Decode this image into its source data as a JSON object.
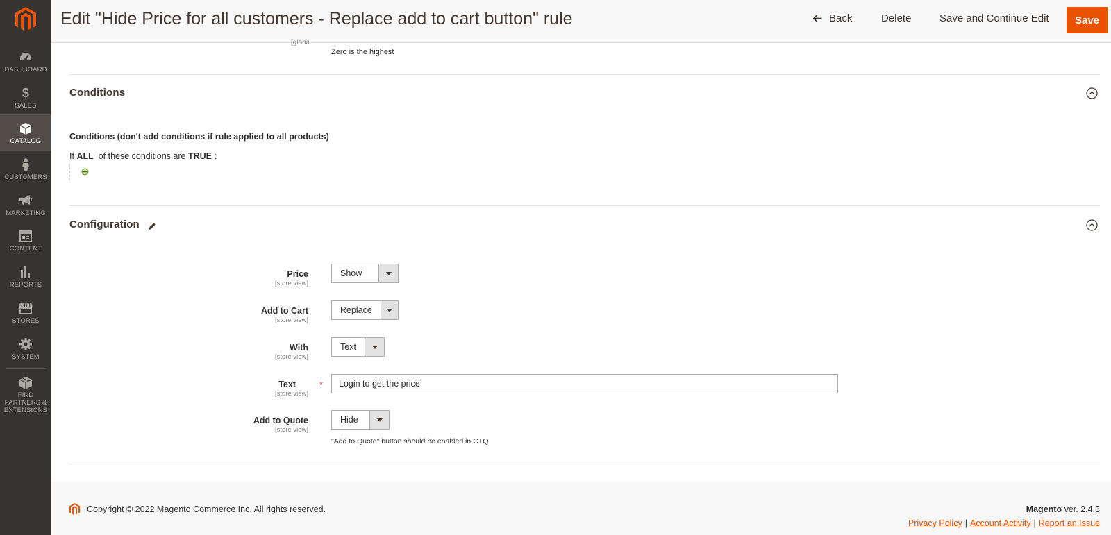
{
  "header": {
    "title": "Edit \"Hide Price for all customers - Replace add to cart button\" rule",
    "back_label": "Back",
    "delete_label": "Delete",
    "save_continue_label": "Save and Continue Edit",
    "save_label": "Save"
  },
  "sidebar": {
    "items": [
      {
        "label": "DASHBOARD",
        "icon": "dashboard-icon"
      },
      {
        "label": "SALES",
        "icon": "dollar-icon"
      },
      {
        "label": "CATALOG",
        "icon": "box-icon",
        "active": true
      },
      {
        "label": "CUSTOMERS",
        "icon": "person-icon"
      },
      {
        "label": "MARKETING",
        "icon": "megaphone-icon"
      },
      {
        "label": "CONTENT",
        "icon": "layout-icon"
      },
      {
        "label": "REPORTS",
        "icon": "bar-chart-icon"
      },
      {
        "label": "STORES",
        "icon": "storefront-icon"
      },
      {
        "label": "SYSTEM",
        "icon": "gear-icon"
      },
      {
        "label": "FIND PARTNERS & EXTENSIONS",
        "icon": "cubes-icon"
      }
    ]
  },
  "priority": {
    "scope": "[global]",
    "note": "Zero is the highest"
  },
  "conditions": {
    "section_title": "Conditions",
    "heading": "Conditions (don't add conditions if rule applied to all products)",
    "prefix": "If",
    "aggregator": "ALL",
    "middle": "of these conditions are",
    "value": "TRUE",
    "suffix": ":"
  },
  "configuration": {
    "section_title": "Configuration",
    "fields": {
      "price": {
        "label": "Price",
        "scope": "[store view]",
        "value": "Show"
      },
      "add_to_cart": {
        "label": "Add to Cart",
        "scope": "[store view]",
        "value": "Replace"
      },
      "with": {
        "label": "With",
        "scope": "[store view]",
        "value": "Text"
      },
      "text": {
        "label": "Text",
        "scope": "[store view]",
        "value": "Login to get the price!",
        "required": "*"
      },
      "add_to_quote": {
        "label": "Add to Quote",
        "scope": "[store view]",
        "value": "Hide",
        "note": "\"Add to Quote\" button should be enabled in CTQ"
      }
    }
  },
  "footer": {
    "copyright": "Copyright © 2022 Magento Commerce Inc. All rights reserved.",
    "brand": "Magento",
    "version": "ver. 2.4.3",
    "links": [
      "Privacy Policy",
      "Account Activity",
      "Report an Issue"
    ]
  },
  "colors": {
    "sidebar": "#373330",
    "accent": "#eb5202",
    "active_nav": "#524d49"
  }
}
